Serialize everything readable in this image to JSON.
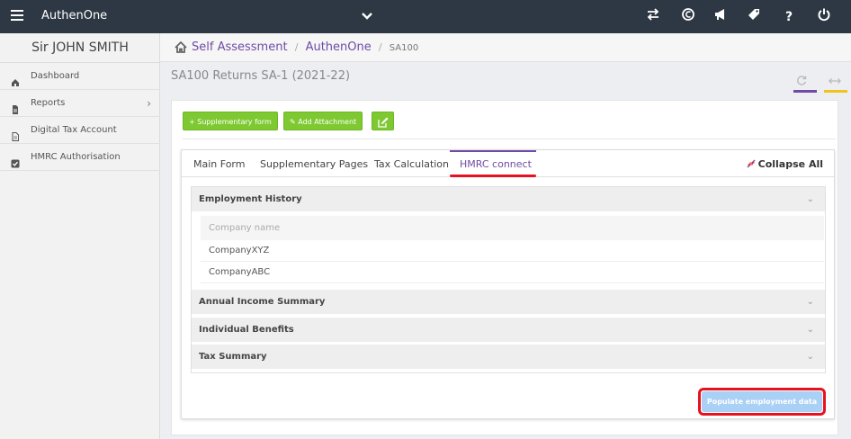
{
  "app": {
    "name": "AuthenOne"
  },
  "topbar": {
    "icons": [
      "menu-icon",
      "chevron-down-icon",
      "transfer-icon",
      "currency-icon",
      "megaphone-icon",
      "tag-icon",
      "help-icon",
      "power-icon"
    ],
    "help_text": "?"
  },
  "sidebar": {
    "user": "Sir JOHN SMITH",
    "items": [
      {
        "label": "Dashboard",
        "icon": "home-icon"
      },
      {
        "label": "Reports",
        "icon": "document-icon",
        "arrow": "›"
      },
      {
        "label": "Digital Tax Account",
        "icon": "file-icon"
      },
      {
        "label": "HMRC Authorisation",
        "icon": "checkbox-icon"
      }
    ]
  },
  "breadcrumb": {
    "items": [
      "Self Assessment",
      "AuthenOne"
    ],
    "separator": "/",
    "current": "SA100"
  },
  "page": {
    "title": "SA100 Returns SA-1 (2021-22)"
  },
  "toolbar": {
    "supplementary_label": "+ Supplementary form",
    "attachment_label": "✎ Add Attachment",
    "edit_icon": "edit-icon"
  },
  "tabs": {
    "items": [
      "Main Form",
      "Supplementary Pages",
      "Tax Calculation",
      "HMRC connect"
    ],
    "active": "HMRC connect",
    "collapse_label": "Collapse All"
  },
  "sections": {
    "employment_history": "Employment History",
    "column_header": "Company name",
    "companies": [
      "CompanyXYZ",
      "CompanyABC"
    ],
    "annual_income": "Annual Income Summary",
    "individual_benefits": "Individual Benefits",
    "tax_summary": "Tax Summary",
    "chevron": "⌄"
  },
  "actions": {
    "populate_label": "Populate employment data"
  },
  "colors": {
    "topbar": "#2d3844",
    "accent": "#6f4ba6",
    "green": "#7ec932",
    "highlight": "#e8121f",
    "populate": "#a9d0f5"
  }
}
